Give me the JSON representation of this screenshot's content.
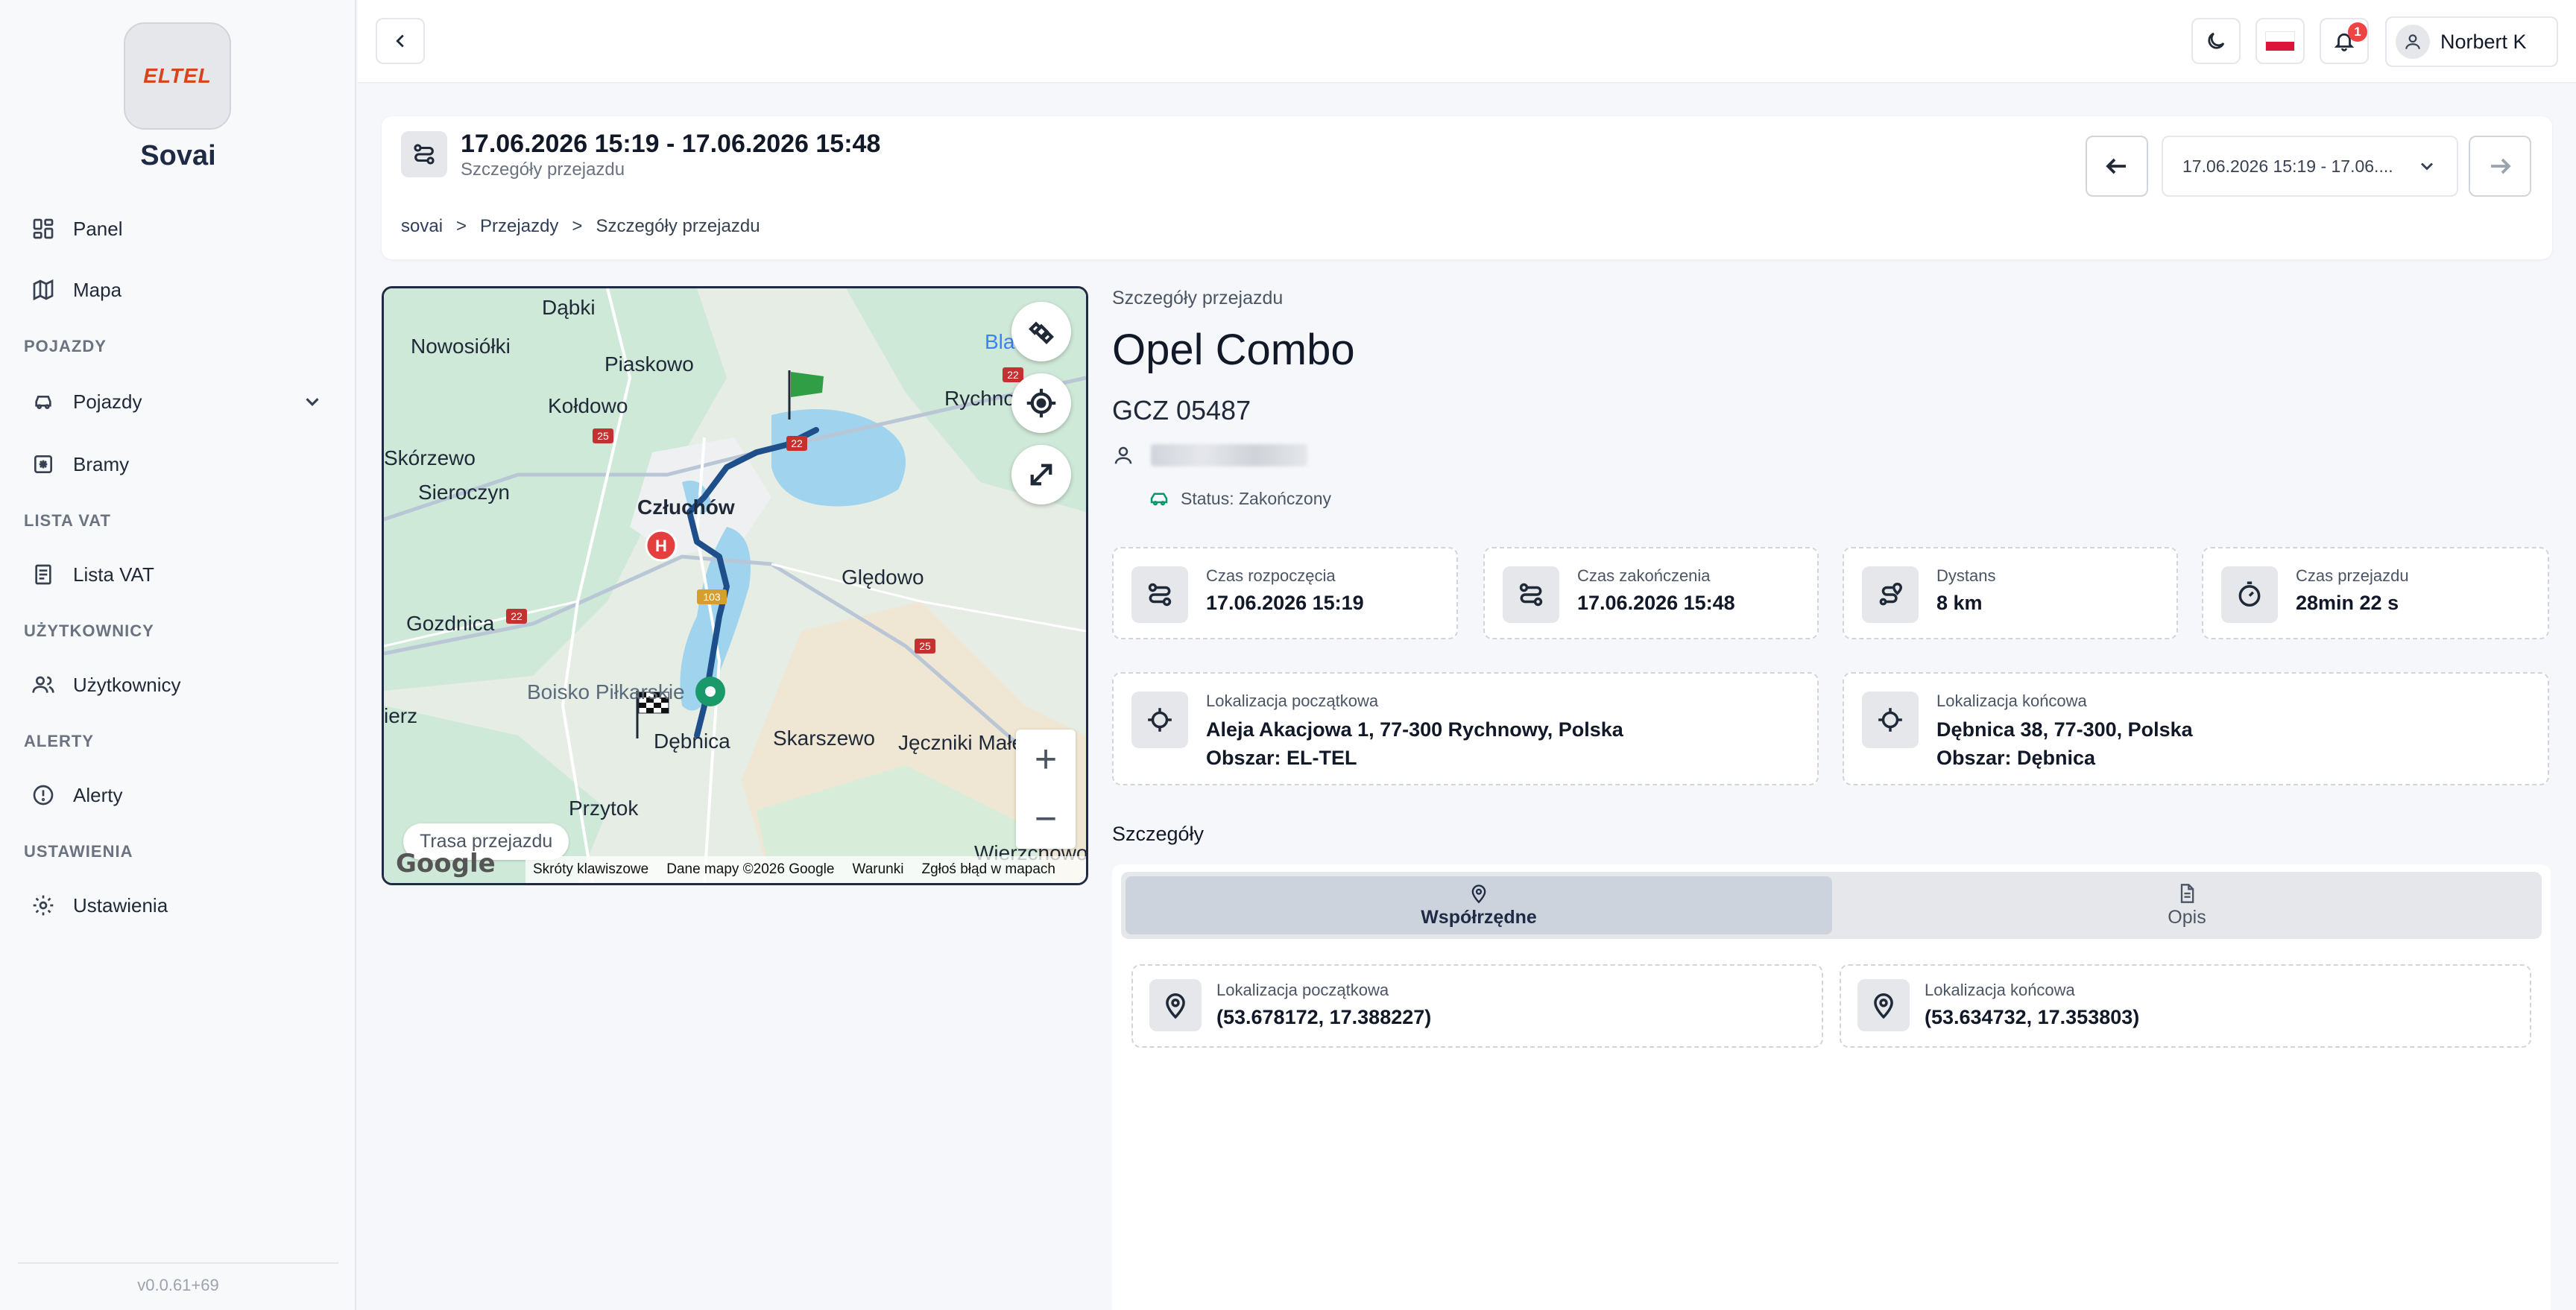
{
  "sidebar": {
    "logo_text": "ELTEL",
    "brand": "Sovai",
    "items": {
      "panel": "Panel",
      "mapa": "Mapa",
      "pojazdy": "Pojazdy",
      "bramy": "Bramy",
      "lista_vat": "Lista VAT",
      "uzytkownicy": "Użytkownicy",
      "alerty": "Alerty",
      "ustawienia": "Ustawienia"
    },
    "sections": {
      "pojazdy": "POJAZDY",
      "lista_vat": "LISTA VAT",
      "uzytkownicy": "UŻYTKOWNICY",
      "alerty": "ALERTY",
      "ustawienia": "USTAWIENIA"
    },
    "version": "v0.0.61+69"
  },
  "topbar": {
    "notification_count": "1",
    "user_name": "Norbert K",
    "flag_colors": {
      "top": "#ffffff",
      "bottom": "#dc143c"
    }
  },
  "header": {
    "title": "17.06.2026 15:19 - 17.06.2026 15:48",
    "subtitle": "Szczegóły przejazdu",
    "breadcrumb": [
      "sovai",
      ">",
      "Przejazdy",
      ">",
      "Szczegóły przejazdu"
    ],
    "trip_select_value": "17.06.2026 15:19 - 17.06...."
  },
  "map": {
    "labels": {
      "dabki": "Dąbki",
      "nowosiolki": "Nowosiółki",
      "piaskowo": "Piaskowo",
      "koldowo": "Kołdowo",
      "skorzewo": "Skórzewo",
      "sieroczyn": "Sieroczyn",
      "czluchow": "Człuchów",
      "gledowo": "Ględowo",
      "gozdnica": "Gozdnica",
      "boisko": "Boisko Piłkarskie",
      "skarszewo": "Skarszewo",
      "jeczniki": "Jęczniki Małe",
      "debnica": "Dębnica",
      "przytok": "Przytok",
      "wierzchowo": "Wierzchowo",
      "rychnowy": "Rychnowy",
      "blad": "Bla",
      "ierz": "ierz"
    },
    "road_badges": [
      "22",
      "25",
      "22",
      "22",
      "103",
      "25"
    ],
    "route_chip": "Trasa przejazdu",
    "google": "Google",
    "footer": [
      "Skróty klawiszowe",
      "Dane mapy ©2026 Google",
      "Warunki",
      "Zgłoś błąd w mapach"
    ],
    "route_color": "#1e4f8a"
  },
  "details": {
    "section_label": "Szczegóły przejazdu",
    "vehicle": "Opel Combo",
    "plate": "GCZ 05487",
    "status": "Status: Zakończony",
    "stats": {
      "start_label": "Czas rozpoczęcia",
      "start_value": "17.06.2026 15:19",
      "end_label": "Czas zakończenia",
      "end_value": "17.06.2026 15:48",
      "distance_label": "Dystans",
      "distance_value": "8 km",
      "duration_label": "Czas przejazdu",
      "duration_value": "28min 22 s"
    },
    "start_loc": {
      "label": "Lokalizacja początkowa",
      "address": "Aleja Akacjowa 1, 77-300 Rychnowy, Polska",
      "area": "Obszar: EL-TEL"
    },
    "end_loc": {
      "label": "Lokalizacja końcowa",
      "address": "Dębnica 38, 77-300, Polska",
      "area": "Obszar: Dębnica"
    },
    "szczegoly_label": "Szczegóły",
    "tabs": {
      "coords": "Współrzędne",
      "desc": "Opis"
    },
    "coords": {
      "start_label": "Lokalizacja początkowa",
      "start_value": "(53.678172, 17.388227)",
      "end_label": "Lokalizacja końcowa",
      "end_value": "(53.634732, 17.353803)"
    }
  }
}
